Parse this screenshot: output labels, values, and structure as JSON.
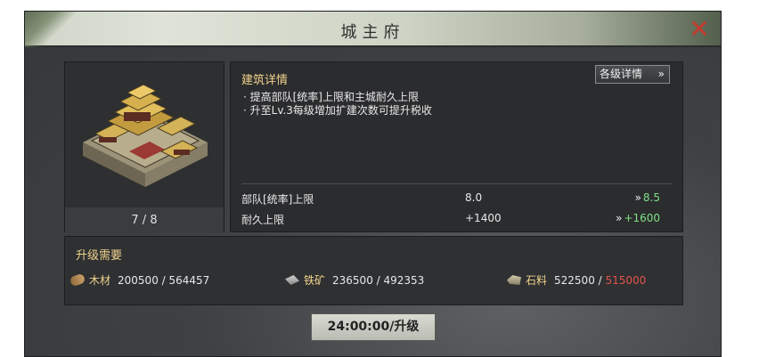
{
  "window": {
    "title": "城主府",
    "close_icon": "close-icon"
  },
  "building": {
    "level": "7 / 8"
  },
  "details": {
    "title": "建筑详情",
    "button_label": "各级详情",
    "button_icon": "double-chevron-right-icon",
    "descriptions": [
      "· 提高部队[统率]上限和主城耐久上限",
      "· 升至Lv.3每级增加扩建次数可提升税收"
    ],
    "stats": [
      {
        "name": "部队[统率]上限",
        "current": "8.0",
        "next": "8.5"
      },
      {
        "name": "耐久上限",
        "current": "+1400",
        "next": "+1600"
      }
    ]
  },
  "requirements": {
    "title": "升级需要",
    "resources": [
      {
        "icon": "wood-icon",
        "name": "木材",
        "have": "200500",
        "need": "564457",
        "sufficient": true
      },
      {
        "icon": "iron-ore-icon",
        "name": "铁矿",
        "have": "236500",
        "need": "492353",
        "sufficient": true
      },
      {
        "icon": "stone-icon",
        "name": "石料",
        "have": "522500",
        "need": "515000",
        "sufficient": false
      }
    ]
  },
  "upgrade_button": {
    "label": "24:00:00/升级"
  },
  "colors": {
    "accent_gold": "#f1d38c",
    "increase_green": "#7de084",
    "shortage_red": "#e4544a",
    "close_red": "#c43a2c"
  }
}
